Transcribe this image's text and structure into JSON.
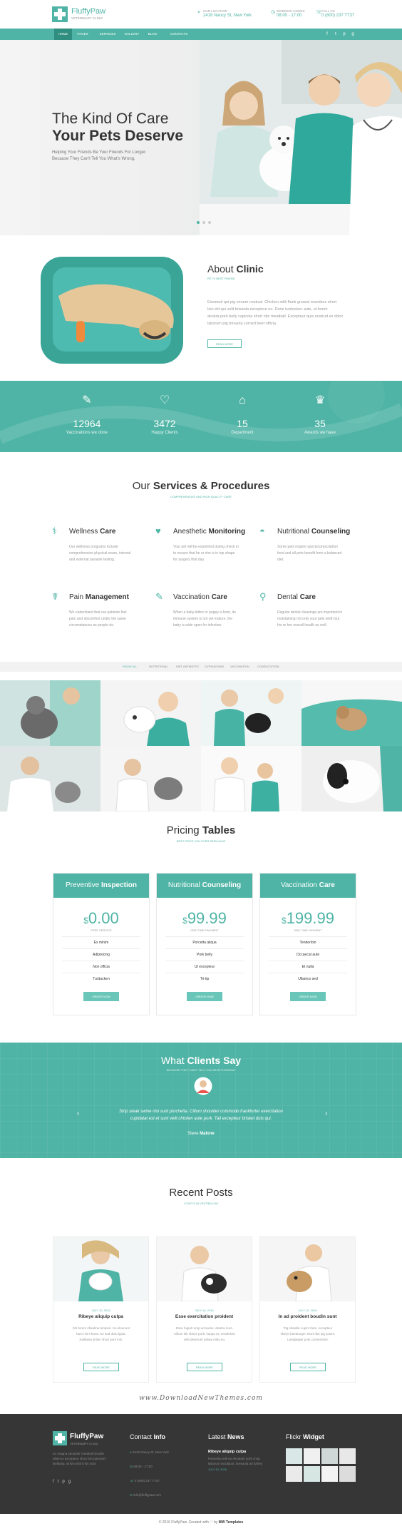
{
  "brand": {
    "name": "FluffyPaw",
    "tagline": "VETERINARY CLINIC"
  },
  "header": {
    "location_label": "OUR LOCATION",
    "location": "2418 Nancy St, New York",
    "hours_label": "WORKING HOURS",
    "hours": "08:00 - 17:00",
    "phone_label": "CALL US",
    "phone": "0 (800) 237 TT37"
  },
  "nav": {
    "items": [
      "HOME",
      "PAGES",
      "SERVICES",
      "GALLERY",
      "BLOG",
      "CONTACTS"
    ],
    "active": "HOME"
  },
  "social_icons": [
    "facebook-icon",
    "twitter-icon",
    "pinterest-icon",
    "google-plus-icon"
  ],
  "hero": {
    "line1": "The Kind Of Care",
    "line2": "Your Pets Deserve",
    "sub1": "Helping Your Friends Be Your Friends For Longer.",
    "sub2": "Because They Can't Tell You What's Wrong."
  },
  "about": {
    "title_light": "About",
    "title_bold": "Clinic",
    "subtitle": "PET'S BEST FRIEND",
    "text1": "Eiusmod qui pig venam nostrud. Chicken milk flank ground roundsez short",
    "text2": "loin elit qui velit brisaola excepteur eu. Dorie turducken aute, ut lorem",
    "text3": "alcatra pork belly capicola short ribs meatball. Excepteur quis nostrud ex dolor",
    "text4": "laborum pig brisaola corned beef officia.",
    "button": "READ MORE"
  },
  "stats": [
    {
      "icon": "syringe-icon",
      "value": "12964",
      "label": "Vaccinations we done"
    },
    {
      "icon": "heart-shield-icon",
      "value": "3472",
      "label": "Happy Clients"
    },
    {
      "icon": "house-icon",
      "value": "15",
      "label": "Department"
    },
    {
      "icon": "trophy-icon",
      "value": "35",
      "label": "Awards we have"
    }
  ],
  "services": {
    "title_light": "Our",
    "title_bold": "Services & Procedures",
    "subtitle": "COMPREHENSIVE AND HIGH QUALITY CARE",
    "items": [
      {
        "icon": "stethoscope-icon",
        "light": "Wellness",
        "bold": "Care",
        "t1": "Our wellness programs include",
        "t2": "comprehensive physical exam, internal",
        "t3": "and external parasite testing."
      },
      {
        "icon": "heartbeat-icon",
        "light": "Anesthetic",
        "bold": "Monitoring",
        "t1": "Your pet will be examined during check in",
        "t2": "to ensure that he or she is in top shape",
        "t3": "for surgery that day."
      },
      {
        "icon": "bowl-icon",
        "light": "Nutritional",
        "bold": "Counseling",
        "t1": "Some pets require special prescription",
        "t2": "food and all pets benefit from a balanced",
        "t3": "diet."
      },
      {
        "icon": "pain-icon",
        "light": "Pain",
        "bold": "Management",
        "t1": "We understand that our patients feel",
        "t2": "pain and discomfort under the same",
        "t3": "circumstances as people do."
      },
      {
        "icon": "syringe-icon",
        "light": "Vaccination",
        "bold": "Care",
        "t1": "When a baby kitten or puppy is born, its",
        "t2": "immune system is not yet mature, the",
        "t3": "baby is wide open for infection."
      },
      {
        "icon": "tooth-icon",
        "light": "Dental",
        "bold": "Care",
        "t1": "Regular dental cleanings are important in",
        "t2": "maintaining not only your pets teeth but",
        "t3": "his or her overall health as well."
      }
    ]
  },
  "gallery": {
    "filters": [
      "SHOW ALL",
      "NUTRITIONAL",
      "DIET ANTIBIOTIC",
      "ULTRASOUND",
      "VACCINATION",
      "CONSULTATION"
    ]
  },
  "pricing": {
    "title_light": "Pricing",
    "title_bold": "Tables",
    "subtitle": "BEST PRICE YOU EVER SEEN NOW",
    "plans": [
      {
        "light": "Preventive",
        "bold": "Inspection",
        "currency": "$",
        "price": "0.00",
        "note": "FREE SERVICE",
        "features": [
          "Ex minim",
          "Adipisicing",
          "Non officia",
          "Turducken"
        ],
        "button": "ORDER NOW"
      },
      {
        "light": "Nutritional",
        "bold": "Counseling",
        "currency": "$",
        "price": "99.99",
        "note": "ONE-TIME PAYMENT",
        "features": [
          "Porcetta aliqua",
          "Pork belly",
          "Ut excepteur",
          "Tri-tip"
        ],
        "button": "ORDER NOW"
      },
      {
        "light": "Vaccination",
        "bold": "Care",
        "currency": "$",
        "price": "199.99",
        "note": "ONE-TIME PAYMENT",
        "features": [
          "Tenderloin",
          "Occaecat aute",
          "Et nulla",
          "Ullamco sed"
        ],
        "button": "ORDER NOW"
      }
    ]
  },
  "testimonial": {
    "title_light": "What",
    "title_bold": "Clients Say",
    "subtitle": "BECAUSE THEY CAN'T TELL YOU WHAT'S WRONG",
    "quote1": "Strip steak swine nisi sunt porchetta. Cillum shoulder commodo frankfurter exercitation",
    "quote2": "cupidatat est et sunt velit chicken aute pork. Tail excepteur brisket duis qui.",
    "author_first": "Steve",
    "author_last": "Malone"
  },
  "posts": {
    "title": "Recent Posts",
    "subtitle": "LOVE IS IN VESTIBULUM",
    "items": [
      {
        "date": "JULY 10, 2016",
        "title": "Ribeye aliquip culpa",
        "t1": "Est lorem ribsalma tempori. Su eleenunt",
        "t2": "bum nisi t-bone. Ex sed duis ligula.",
        "t3": "Kielbasa sirloin short pork loin.",
        "button": "READ MORE"
      },
      {
        "date": "JULY 10, 2016",
        "title": "Esse exercitation proident",
        "t1": "Esse fugiat rump ad swine, alcatra irure.",
        "t2": "Cillum elit ribeye pork, kuppa ex, tenderloin",
        "t3": "velit deserunt turkey nulla eu.",
        "button": "READ MORE"
      },
      {
        "date": "JULY 10, 2016",
        "title": "In ad proident boudin sunt",
        "t1": "Pig shankle cupim ham, excepteur",
        "t2": "ribeye hamburger short ribs pig ipsum.",
        "t3": "Landjaeger pork consectetur.",
        "button": "READ MORE"
      }
    ]
  },
  "watermark": "www.DownloadNewThemes.com",
  "footer": {
    "about_text1": "Ex magna shoulder meatloaf boudin",
    "about_text2": "ullamco excepteur short loin pastrami",
    "about_text3": "kielbasa, sirloin short ribs sunt.",
    "contact_light": "Contact",
    "contact_bold": "Info",
    "address": "2418 Nancy St, New York",
    "hours": "08:00 - 17:00",
    "phone": "0 (800) 237 TT37",
    "email": "info@fluffypaw.com",
    "news_light": "Latest",
    "news_bold": "News",
    "news_title": "Ribeye aliquip culpa",
    "news_text1": "Pancetta velit eu shoulder pork chop",
    "news_text2": "laborum incididunt, bresaola ad turkey",
    "news_date": "JULY 10, 2016",
    "flickr_light": "Flickr",
    "flickr_bold": "Widget"
  },
  "copyright": {
    "text": "© 2016 FluffyPaw. Created with ♡ by",
    "author": "MW Templates"
  },
  "colors": {
    "accent": "#4fb4a5",
    "accent_dark": "#2f8e80",
    "footer": "#363636"
  }
}
